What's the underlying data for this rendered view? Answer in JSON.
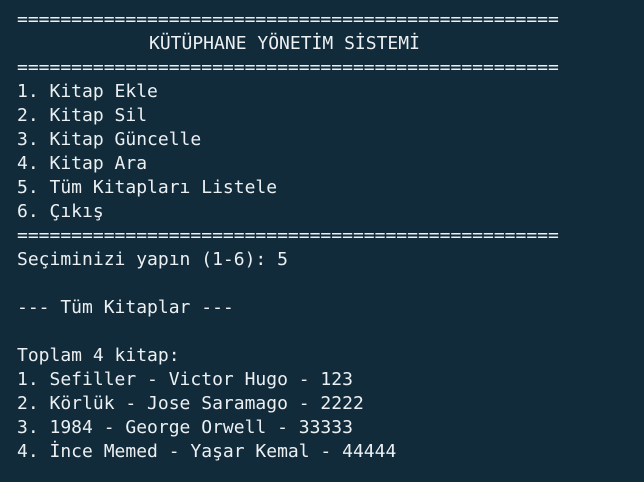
{
  "terminal": {
    "separator_top": "==================================================",
    "title": "KÜTÜPHANE YÖNETİM SİSTEMİ",
    "separator_mid": "==================================================",
    "menu": [
      "1. Kitap Ekle",
      "2. Kitap Sil",
      "3. Kitap Güncelle",
      "4. Kitap Ara",
      "5. Tüm Kitapları Listele",
      "6. Çıkış"
    ],
    "separator_bottom": "==================================================",
    "prompt": "Seçiminizi yapın (1-6): 5",
    "section_header": "--- Tüm Kitaplar ---",
    "total": "Toplam 4 kitap:",
    "books": [
      "1. Sefiller - Victor Hugo - 123",
      "2. Körlük - Jose Saramago - 2222",
      "3. 1984 - George Orwell - 33333",
      "4. İnce Memed - Yaşar Kemal - 44444"
    ]
  }
}
